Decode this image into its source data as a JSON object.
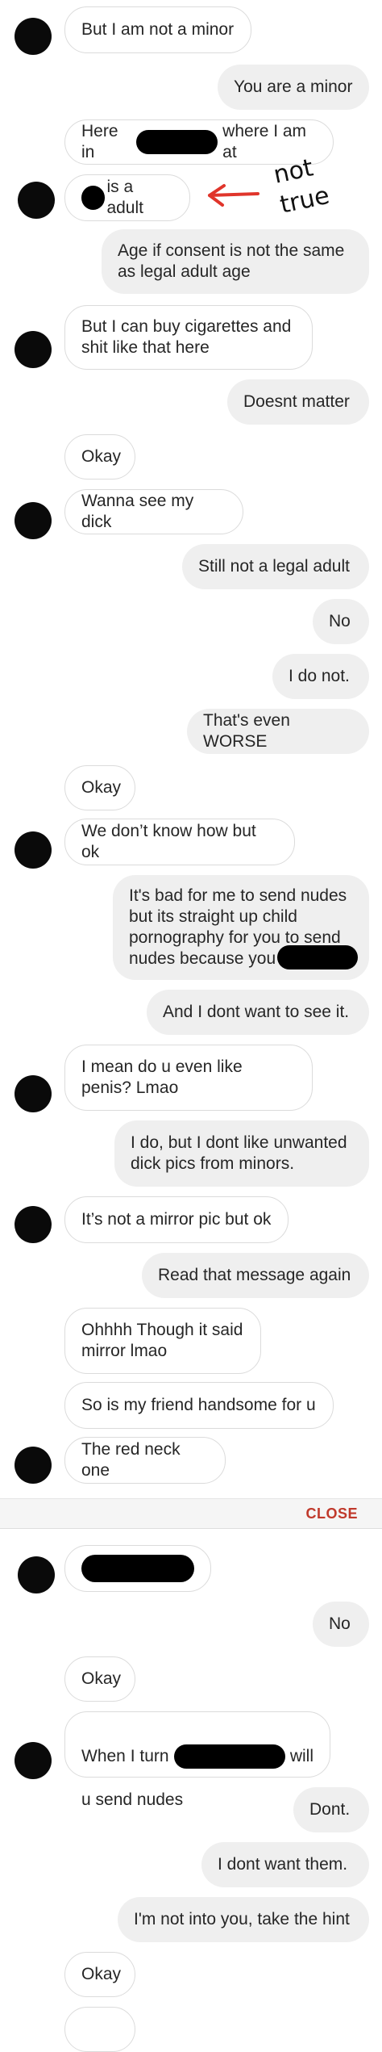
{
  "messages": {
    "m1": "But I am not a minor",
    "m2": "You are a minor",
    "m3a": "Here in",
    "m3b": "where I am at",
    "m4": "is a adult",
    "m5": "Age if consent is not the same\nas legal adult age",
    "m6": "But I can buy cigarettes and\nshit like that here",
    "m7": "Doesnt matter",
    "m8": "Okay",
    "m9": "Wanna see my dick",
    "m10": "Still not a legal adult",
    "m11": "No",
    "m12": "I do not.",
    "m13": "That's even WORSE",
    "m14": "Okay",
    "m15": "We don’t know how but ok",
    "m16a": "It's bad for me to send nudes\nbut its straight up child\npornography for you to send\nnudes because you",
    "m17": "And I dont want to see it.",
    "m18": "I mean do u even like\npenis? Lmao",
    "m19": "I do, but I dont like unwanted\ndick pics from minors.",
    "m20": "It’s not a mirror pic but ok",
    "m21": "Read that message again",
    "m22": "Ohhhh Though it said\nmirror lmao",
    "m23": "So is my friend handsome for u",
    "m24": "The red neck one",
    "m25": "No",
    "m26": "Okay",
    "m27a": "When I turn",
    "m27b": "will",
    "m27c": "u send nudes",
    "m28": "Dont.",
    "m29": "I dont want them.",
    "m30": "I'm not into you, take the hint",
    "m31": "Okay"
  },
  "annotation": {
    "text": "not true",
    "color": "#e0352b"
  },
  "viewer": {
    "close_label": "CLOSE",
    "close_color": "#c0392b"
  },
  "colors": {
    "incoming_border": "#dbdbdb",
    "outgoing_bg": "#efefef",
    "text": "#262626"
  }
}
